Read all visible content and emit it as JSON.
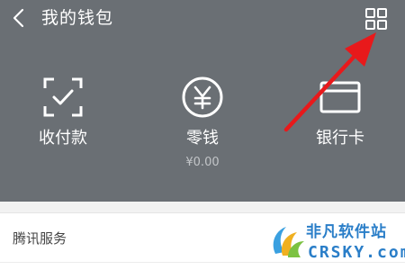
{
  "header": {
    "title": "我的钱包",
    "back_icon": "chevron-left-icon",
    "menu_icon": "grid-icon",
    "background_color": "#6a6f74"
  },
  "tiles": [
    {
      "label": "收付款",
      "icon": "scan-check-icon"
    },
    {
      "label": "零钱",
      "icon": "yen-circle-icon",
      "sub": "¥0.00"
    },
    {
      "label": "银行卡",
      "icon": "bank-card-icon"
    }
  ],
  "section": {
    "title": "腾讯服务"
  },
  "annotation": {
    "type": "arrow",
    "color": "#e8191b"
  },
  "watermark": {
    "cn": "非凡软件站",
    "en": "CRSKY.com",
    "color": "#2a7ec8"
  }
}
